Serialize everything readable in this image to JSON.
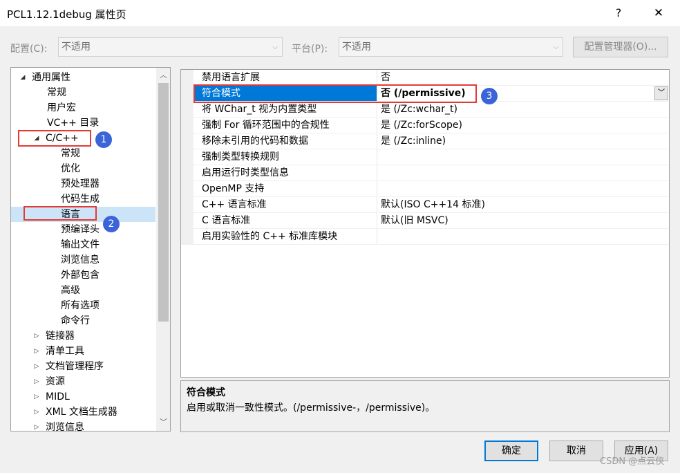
{
  "window": {
    "title": "PCL1.12.1debug 属性页",
    "help_glyph": "?",
    "close_glyph": "✕"
  },
  "config_row": {
    "config_label": "配置(C):",
    "config_value": "不适用",
    "platform_label": "平台(P):",
    "platform_value": "不适用",
    "manager_button": "配置管理器(O)..."
  },
  "tree": {
    "items": [
      {
        "label": "通用属性",
        "expander": "◢"
      },
      {
        "label": "常规"
      },
      {
        "label": "用户宏"
      },
      {
        "label": "VC++ 目录"
      },
      {
        "label": "C/C++",
        "expander": "◢"
      },
      {
        "label": "常规"
      },
      {
        "label": "优化"
      },
      {
        "label": "预处理器"
      },
      {
        "label": "代码生成"
      },
      {
        "label": "语言"
      },
      {
        "label": "预编译头"
      },
      {
        "label": "输出文件"
      },
      {
        "label": "浏览信息"
      },
      {
        "label": "外部包含"
      },
      {
        "label": "高级"
      },
      {
        "label": "所有选项"
      },
      {
        "label": "命令行"
      },
      {
        "label": "链接器",
        "expander": "▷"
      },
      {
        "label": "清单工具",
        "expander": "▷"
      },
      {
        "label": "文档管理程序",
        "expander": "▷"
      },
      {
        "label": "资源",
        "expander": "▷"
      },
      {
        "label": "MIDL",
        "expander": "▷"
      },
      {
        "label": "XML 文档生成器",
        "expander": "▷"
      },
      {
        "label": "浏览信息",
        "expander": "▷"
      }
    ],
    "selected_index": 9
  },
  "properties": [
    {
      "name": "禁用语言扩展",
      "value": "否"
    },
    {
      "name": "符合模式",
      "value": "否 (/permissive)"
    },
    {
      "name": "将 WChar_t 视为内置类型",
      "value": "是 (/Zc:wchar_t)"
    },
    {
      "name": "强制 For 循环范围中的合规性",
      "value": "是 (/Zc:forScope)"
    },
    {
      "name": "移除未引用的代码和数据",
      "value": "是 (/Zc:inline)"
    },
    {
      "name": "强制类型转换规则",
      "value": ""
    },
    {
      "name": "启用运行时类型信息",
      "value": ""
    },
    {
      "name": "OpenMP 支持",
      "value": ""
    },
    {
      "name": "C++ 语言标准",
      "value": "默认(ISO C++14 标准)"
    },
    {
      "name": "C 语言标准",
      "value": "默认(旧 MSVC)"
    },
    {
      "name": "启用实验性的 C++ 标准库模块",
      "value": ""
    }
  ],
  "selected_property_index": 1,
  "description": {
    "title": "符合模式",
    "text": "启用或取消一致性模式。(/permissive-，/permissive)。"
  },
  "buttons": {
    "ok": "确定",
    "cancel": "取消",
    "apply": "应用(A)"
  },
  "annotations": {
    "badge1": "1",
    "badge2": "2",
    "badge3": "3",
    "annotation_color": "#e53935",
    "badge_color": "#3b64d9"
  },
  "watermark": "CSDN @点云侠",
  "colors": {
    "selection": "#0078d7",
    "tree_selection": "#cce4f7",
    "primary_button_border": "#0078d7"
  }
}
